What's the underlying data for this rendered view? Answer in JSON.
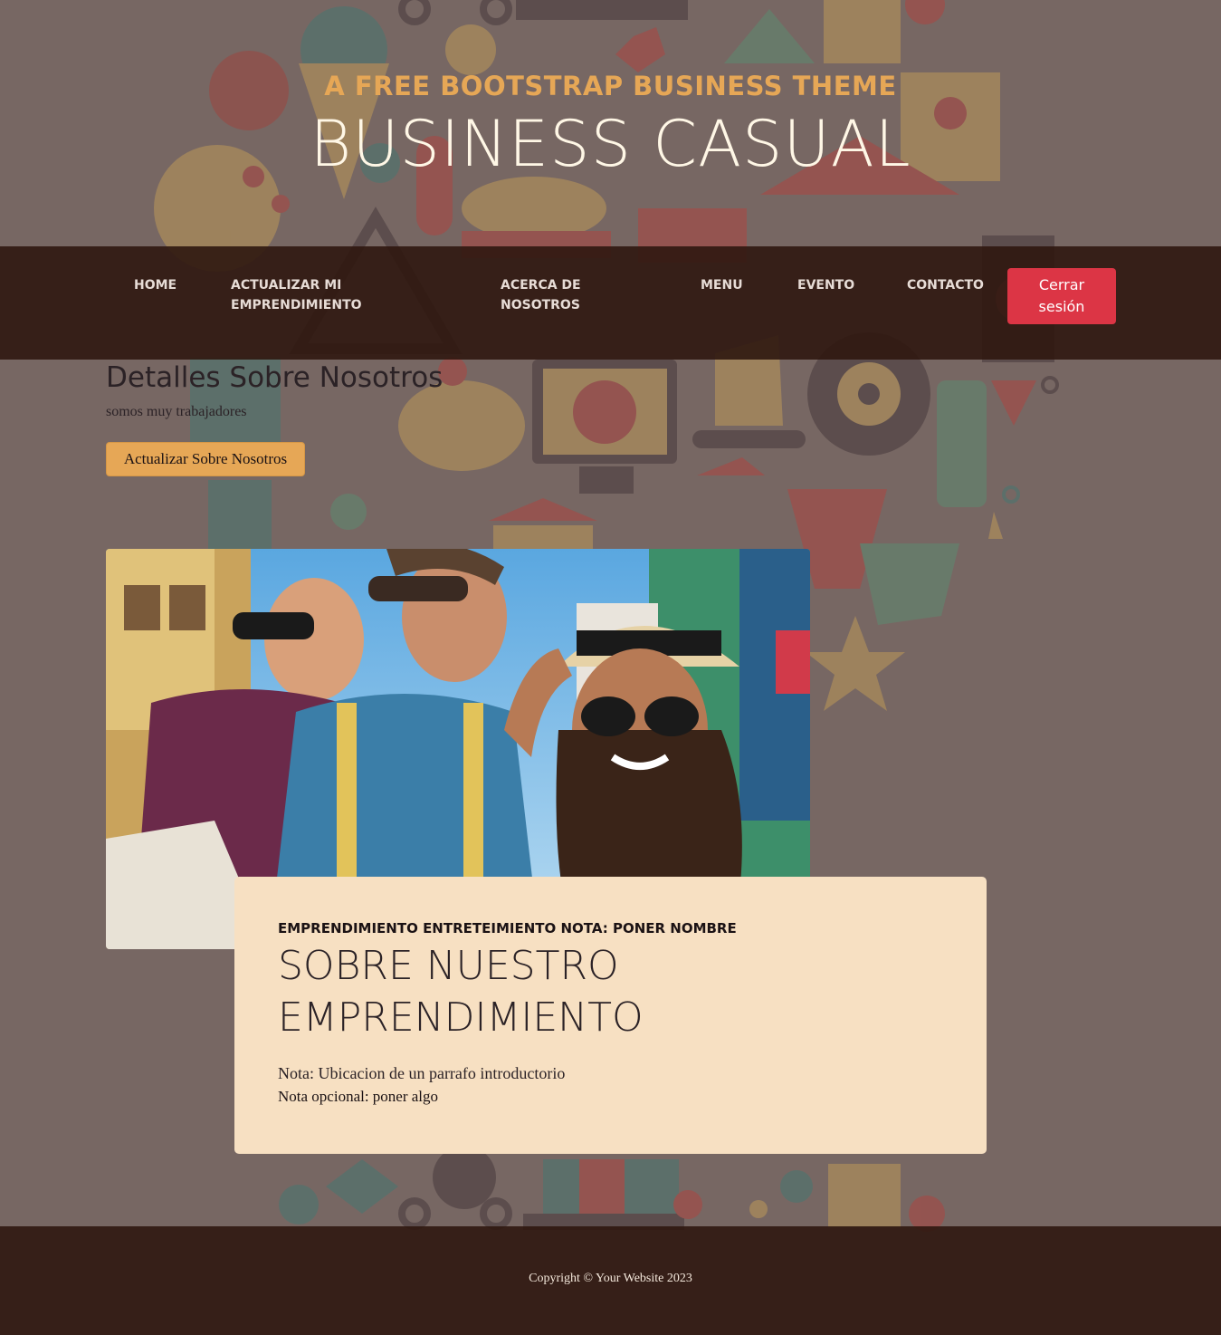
{
  "header": {
    "upper": "A Free Bootstrap Business Theme",
    "lower": "Business Casual"
  },
  "nav": {
    "items": [
      {
        "label_line1": "HOME",
        "label_line2": ""
      },
      {
        "label_line1": "ACTUALIZAR MI",
        "label_line2": "EMPRENDIMIENTO"
      },
      {
        "label_line1": "ACERCA DE",
        "label_line2": "NOSOTROS"
      },
      {
        "label_line1": "MENU",
        "label_line2": ""
      },
      {
        "label_line1": "EVENTO",
        "label_line2": ""
      },
      {
        "label_line1": "CONTACTO",
        "label_line2": ""
      }
    ],
    "logout_line1": "Cerrar",
    "logout_line2": "sesión"
  },
  "about": {
    "title": "Detalles Sobre Nosotros",
    "text": "somos muy trabajadores",
    "update_button": "Actualizar Sobre Nosotros"
  },
  "card": {
    "subheading": "EMPRENDIMIENTO ENTRETEIMIENTO NOTA: PONER NOMBRE",
    "heading_line1": "SOBRE NUESTRO",
    "heading_line2": "EMPRENDIMIENTO",
    "paragraph": "Nota: Ubicacion de un parrafo introductorio",
    "optional": "Nota opcional: poner algo"
  },
  "footer": {
    "copyright": "Copyright © Your Website 2023"
  },
  "colors": {
    "accent": "#e6a756",
    "nav_bg": "#2f170f",
    "card_bg": "#f7e0c2",
    "logout": "#dc3545"
  }
}
